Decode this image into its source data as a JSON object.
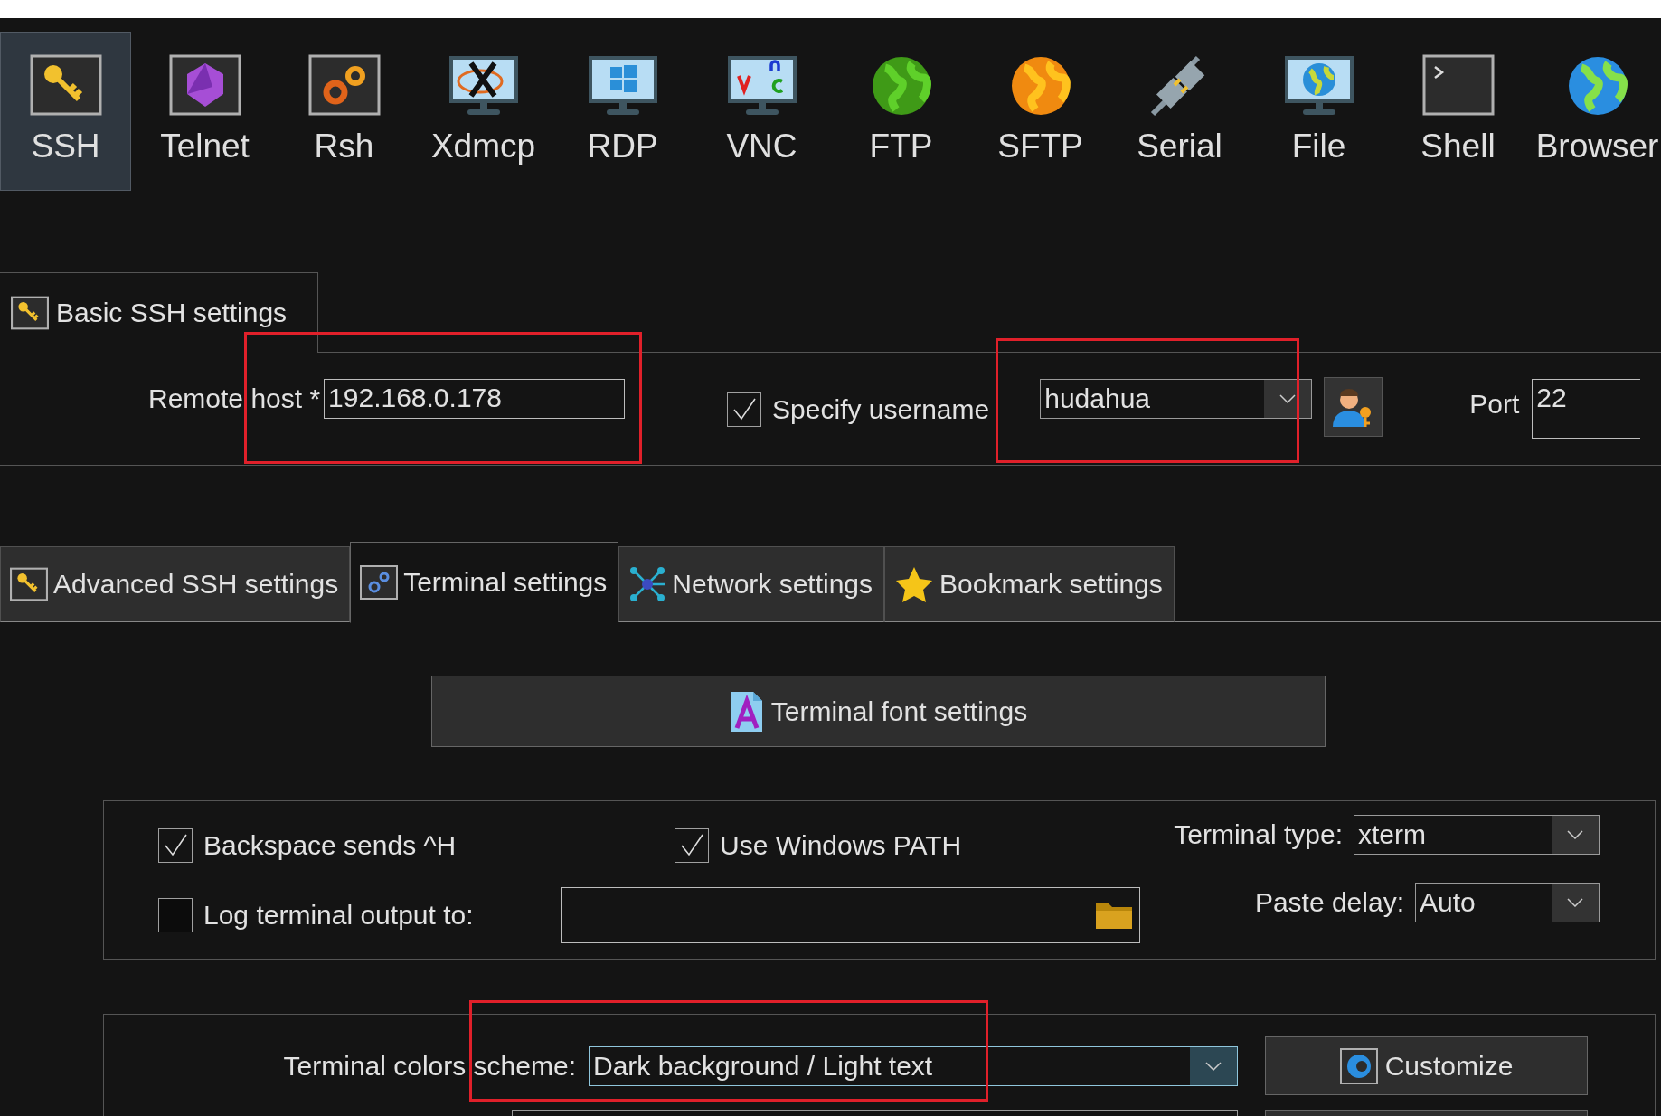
{
  "toolbar": [
    {
      "label": "SSH",
      "selected": true
    },
    {
      "label": "Telnet",
      "selected": false
    },
    {
      "label": "Rsh",
      "selected": false
    },
    {
      "label": "Xdmcp",
      "selected": false
    },
    {
      "label": "RDP",
      "selected": false
    },
    {
      "label": "VNC",
      "selected": false
    },
    {
      "label": "FTP",
      "selected": false
    },
    {
      "label": "SFTP",
      "selected": false
    },
    {
      "label": "Serial",
      "selected": false
    },
    {
      "label": "File",
      "selected": false
    },
    {
      "label": "Shell",
      "selected": false
    },
    {
      "label": "Browser",
      "selected": false
    }
  ],
  "basic_tab": {
    "label": "Basic SSH settings"
  },
  "remote_host": {
    "label": "Remote host *",
    "value": "192.168.0.178",
    "highlighted": true
  },
  "specify_username": {
    "label": "Specify username",
    "checked": true
  },
  "username": {
    "value": "hudahua",
    "highlighted": true
  },
  "port": {
    "label": "Port",
    "value": "22"
  },
  "tabs": [
    {
      "label": "Advanced SSH settings",
      "selected": false
    },
    {
      "label": "Terminal settings",
      "selected": true
    },
    {
      "label": "Network settings",
      "selected": false
    },
    {
      "label": "Bookmark settings",
      "selected": false
    }
  ],
  "font_button": "Terminal font settings",
  "options": [
    {
      "label": "Backspace sends ^H",
      "checked": true
    },
    {
      "label": "Use Windows PATH",
      "checked": true
    },
    {
      "label": "Log terminal output to:",
      "checked": false
    }
  ],
  "terminal_type": {
    "label": "Terminal type:",
    "value": "xterm"
  },
  "paste_delay": {
    "label": "Paste delay:",
    "value": "Auto"
  },
  "color_scheme": {
    "label": "Terminal colors scheme:",
    "value": "Dark background / Light text",
    "highlighted": true
  },
  "customize_button": "Customize"
}
